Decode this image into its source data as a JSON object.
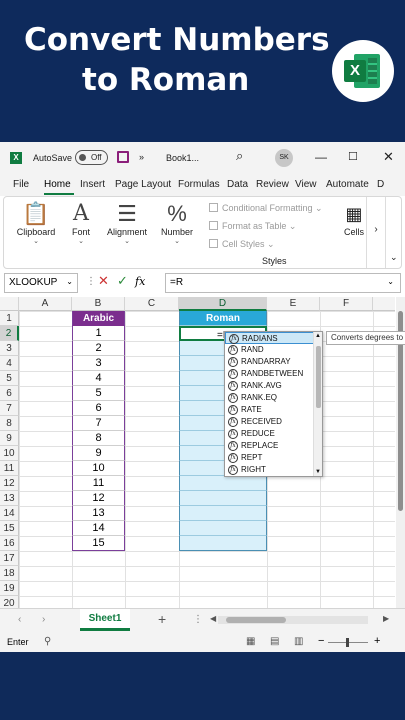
{
  "banner": {
    "title_line1": "Convert Numbers",
    "title_line2": "to Roman",
    "logo_letter": "X"
  },
  "titlebar": {
    "autosave_label": "AutoSave",
    "autosave_state": "Off",
    "more": "»",
    "book": "Book1...",
    "search_icon": "⌕",
    "avatar": "SK",
    "minimize": "—",
    "maximize": "☐",
    "close": "✕"
  },
  "tabs": [
    "File",
    "Home",
    "Insert",
    "Page Layout",
    "Formulas",
    "Data",
    "Review",
    "View",
    "Automate",
    "D"
  ],
  "ribbon": {
    "clipboard": "Clipboard",
    "font": "Font",
    "alignment": "Alignment",
    "number": "Number",
    "number_symbol": "%",
    "conditional": "Conditional Formatting",
    "format_table": "Format as Table",
    "cell_styles": "Cell Styles",
    "styles": "Styles",
    "cells": "Cells",
    "scroll": "›",
    "collapse": "⌄"
  },
  "formula_bar": {
    "name_box": "XLOOKUP",
    "fx": "fx",
    "content": "=R"
  },
  "columns": [
    "A",
    "B",
    "C",
    "D",
    "E",
    "F"
  ],
  "rows": [
    "1",
    "2",
    "3",
    "4",
    "5",
    "6",
    "7",
    "8",
    "9",
    "10",
    "11",
    "12",
    "13",
    "14",
    "15",
    "16",
    "17",
    "18",
    "19",
    "20"
  ],
  "table": {
    "arabic_header": "Arabic",
    "roman_header": "Roman",
    "arabic_values": [
      "1",
      "2",
      "3",
      "4",
      "5",
      "6",
      "7",
      "8",
      "9",
      "10",
      "11",
      "12",
      "13",
      "14",
      "15"
    ],
    "active_cell_text": "=R"
  },
  "autocomplete": {
    "items": [
      "RADIANS",
      "RAND",
      "RANDARRAY",
      "RANDBETWEEN",
      "RANK.AVG",
      "RANK.EQ",
      "RATE",
      "RECEIVED",
      "REDUCE",
      "REPLACE",
      "REPT",
      "RIGHT"
    ],
    "highlighted_index": 0,
    "tooltip": "Converts degrees to"
  },
  "sheetbar": {
    "sheet_name": "Sheet1",
    "add": "+"
  },
  "status": {
    "mode": "Enter"
  },
  "colors": {
    "excel_green": "#107c41",
    "arabic_purple": "#7b2e8e",
    "roman_blue": "#29a8d8",
    "roman_fill": "#d9f0fa",
    "banner_navy": "#0e2a5c"
  }
}
